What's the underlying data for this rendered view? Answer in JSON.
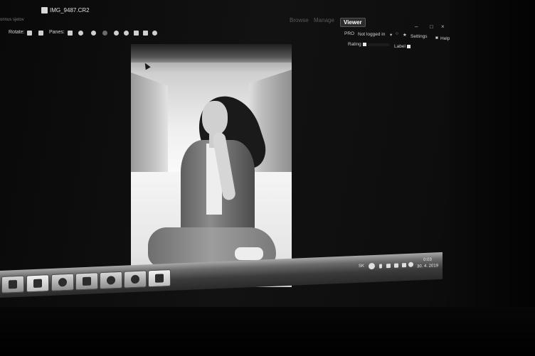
{
  "window": {
    "title": "IMG_9487.CR2",
    "side_label": "onnus sjetov"
  },
  "mode_tabs": [
    {
      "label": "Browse",
      "active": false
    },
    {
      "label": "Manage",
      "active": false
    },
    {
      "label": "Viewer",
      "active": true
    }
  ],
  "toolbar": {
    "rotate_label": "Rotate:",
    "panes_label": "Panes:"
  },
  "header_right": {
    "pro_label": "PRO",
    "account_label": "Not logged in",
    "settings_label": "Settings",
    "help_label": "Help",
    "rating_label": "Rating",
    "label_label": "Label"
  },
  "taskbar": {
    "language": "SK",
    "time": "0:03",
    "date": "30. 4. 2019"
  },
  "colors": {
    "background": "#000000",
    "active_tab": "#2c2c2c",
    "taskbar": "#3b3b3b"
  },
  "icons": [
    "windows-start-icon",
    "store-icon",
    "ie-icon",
    "media-player-icon",
    "chrome-icon",
    "steam-icon",
    "zoner-icon"
  ]
}
